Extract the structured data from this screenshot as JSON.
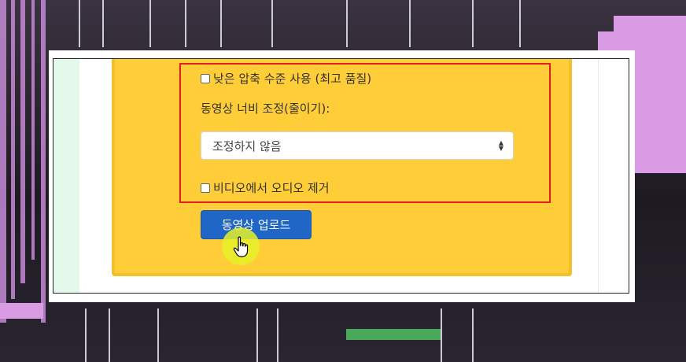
{
  "form": {
    "low_compression_label": "낮은 압축 수준 사용 (최고 품질)",
    "resize_label": "동영상 너비 조정(줄이기):",
    "resize_select_value": "조정하지 않음",
    "remove_audio_label": "비디오에서 오디오 제거",
    "upload_button": "동영상 업로드"
  },
  "colors": {
    "panel": "#ffcd38",
    "highlight_border": "#e02020",
    "button": "#1f66c6"
  },
  "icons": {
    "cursor": "hand-pointer-icon",
    "select_arrows": "up-down-arrows-icon"
  }
}
